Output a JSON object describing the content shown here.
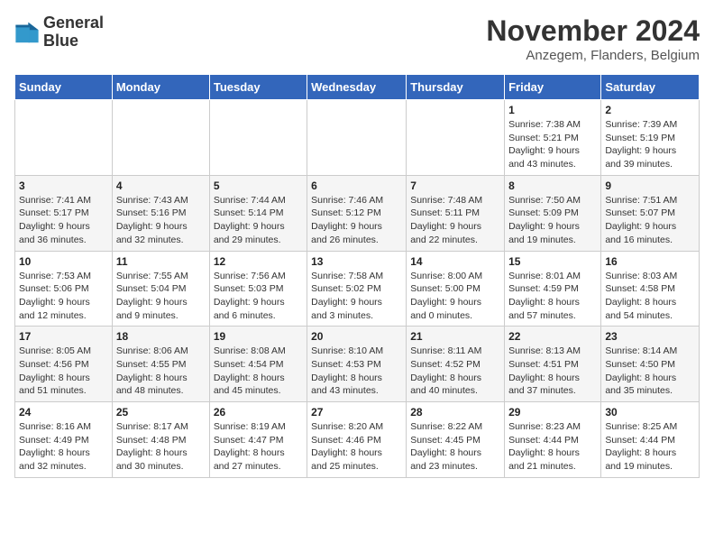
{
  "logo": {
    "line1": "General",
    "line2": "Blue"
  },
  "title": "November 2024",
  "location": "Anzegem, Flanders, Belgium",
  "weekdays": [
    "Sunday",
    "Monday",
    "Tuesday",
    "Wednesday",
    "Thursday",
    "Friday",
    "Saturday"
  ],
  "weeks": [
    [
      {
        "day": "",
        "info": ""
      },
      {
        "day": "",
        "info": ""
      },
      {
        "day": "",
        "info": ""
      },
      {
        "day": "",
        "info": ""
      },
      {
        "day": "",
        "info": ""
      },
      {
        "day": "1",
        "info": "Sunrise: 7:38 AM\nSunset: 5:21 PM\nDaylight: 9 hours\nand 43 minutes."
      },
      {
        "day": "2",
        "info": "Sunrise: 7:39 AM\nSunset: 5:19 PM\nDaylight: 9 hours\nand 39 minutes."
      }
    ],
    [
      {
        "day": "3",
        "info": "Sunrise: 7:41 AM\nSunset: 5:17 PM\nDaylight: 9 hours\nand 36 minutes."
      },
      {
        "day": "4",
        "info": "Sunrise: 7:43 AM\nSunset: 5:16 PM\nDaylight: 9 hours\nand 32 minutes."
      },
      {
        "day": "5",
        "info": "Sunrise: 7:44 AM\nSunset: 5:14 PM\nDaylight: 9 hours\nand 29 minutes."
      },
      {
        "day": "6",
        "info": "Sunrise: 7:46 AM\nSunset: 5:12 PM\nDaylight: 9 hours\nand 26 minutes."
      },
      {
        "day": "7",
        "info": "Sunrise: 7:48 AM\nSunset: 5:11 PM\nDaylight: 9 hours\nand 22 minutes."
      },
      {
        "day": "8",
        "info": "Sunrise: 7:50 AM\nSunset: 5:09 PM\nDaylight: 9 hours\nand 19 minutes."
      },
      {
        "day": "9",
        "info": "Sunrise: 7:51 AM\nSunset: 5:07 PM\nDaylight: 9 hours\nand 16 minutes."
      }
    ],
    [
      {
        "day": "10",
        "info": "Sunrise: 7:53 AM\nSunset: 5:06 PM\nDaylight: 9 hours\nand 12 minutes."
      },
      {
        "day": "11",
        "info": "Sunrise: 7:55 AM\nSunset: 5:04 PM\nDaylight: 9 hours\nand 9 minutes."
      },
      {
        "day": "12",
        "info": "Sunrise: 7:56 AM\nSunset: 5:03 PM\nDaylight: 9 hours\nand 6 minutes."
      },
      {
        "day": "13",
        "info": "Sunrise: 7:58 AM\nSunset: 5:02 PM\nDaylight: 9 hours\nand 3 minutes."
      },
      {
        "day": "14",
        "info": "Sunrise: 8:00 AM\nSunset: 5:00 PM\nDaylight: 9 hours\nand 0 minutes."
      },
      {
        "day": "15",
        "info": "Sunrise: 8:01 AM\nSunset: 4:59 PM\nDaylight: 8 hours\nand 57 minutes."
      },
      {
        "day": "16",
        "info": "Sunrise: 8:03 AM\nSunset: 4:58 PM\nDaylight: 8 hours\nand 54 minutes."
      }
    ],
    [
      {
        "day": "17",
        "info": "Sunrise: 8:05 AM\nSunset: 4:56 PM\nDaylight: 8 hours\nand 51 minutes."
      },
      {
        "day": "18",
        "info": "Sunrise: 8:06 AM\nSunset: 4:55 PM\nDaylight: 8 hours\nand 48 minutes."
      },
      {
        "day": "19",
        "info": "Sunrise: 8:08 AM\nSunset: 4:54 PM\nDaylight: 8 hours\nand 45 minutes."
      },
      {
        "day": "20",
        "info": "Sunrise: 8:10 AM\nSunset: 4:53 PM\nDaylight: 8 hours\nand 43 minutes."
      },
      {
        "day": "21",
        "info": "Sunrise: 8:11 AM\nSunset: 4:52 PM\nDaylight: 8 hours\nand 40 minutes."
      },
      {
        "day": "22",
        "info": "Sunrise: 8:13 AM\nSunset: 4:51 PM\nDaylight: 8 hours\nand 37 minutes."
      },
      {
        "day": "23",
        "info": "Sunrise: 8:14 AM\nSunset: 4:50 PM\nDaylight: 8 hours\nand 35 minutes."
      }
    ],
    [
      {
        "day": "24",
        "info": "Sunrise: 8:16 AM\nSunset: 4:49 PM\nDaylight: 8 hours\nand 32 minutes."
      },
      {
        "day": "25",
        "info": "Sunrise: 8:17 AM\nSunset: 4:48 PM\nDaylight: 8 hours\nand 30 minutes."
      },
      {
        "day": "26",
        "info": "Sunrise: 8:19 AM\nSunset: 4:47 PM\nDaylight: 8 hours\nand 27 minutes."
      },
      {
        "day": "27",
        "info": "Sunrise: 8:20 AM\nSunset: 4:46 PM\nDaylight: 8 hours\nand 25 minutes."
      },
      {
        "day": "28",
        "info": "Sunrise: 8:22 AM\nSunset: 4:45 PM\nDaylight: 8 hours\nand 23 minutes."
      },
      {
        "day": "29",
        "info": "Sunrise: 8:23 AM\nSunset: 4:44 PM\nDaylight: 8 hours\nand 21 minutes."
      },
      {
        "day": "30",
        "info": "Sunrise: 8:25 AM\nSunset: 4:44 PM\nDaylight: 8 hours\nand 19 minutes."
      }
    ]
  ]
}
